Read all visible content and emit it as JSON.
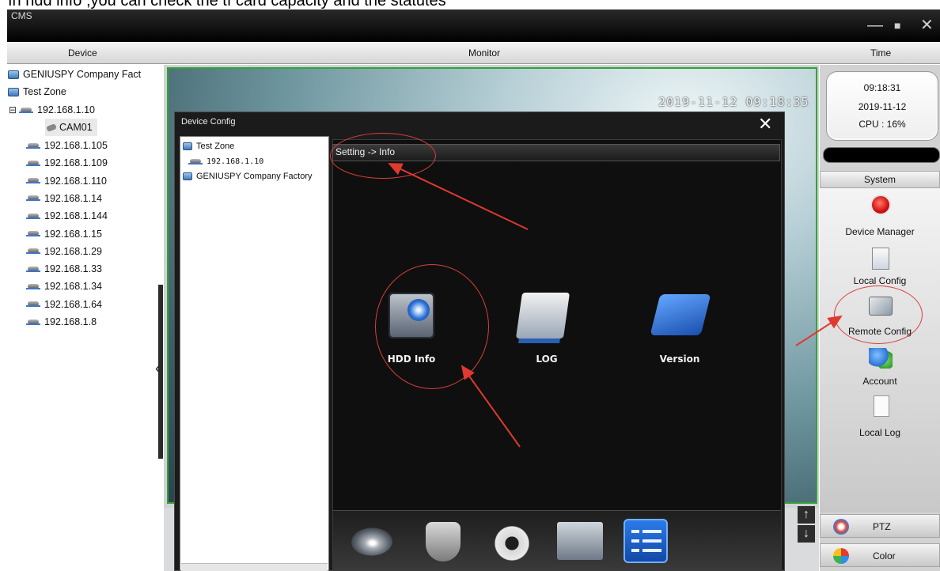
{
  "caption": "In hdd info ,you can check the tf card capacity and the statutes",
  "window": {
    "title": "CMS",
    "controls": {
      "minimize": "—",
      "maximize": "■",
      "close": "✕"
    }
  },
  "headers": {
    "device": "Device",
    "monitor": "Monitor",
    "time": "Time"
  },
  "device_tree": {
    "group_factory": "GENIUSPY Company Fact",
    "group_test_zone": "Test Zone",
    "expander": "⊟",
    "device_selected": "192.168.1.10",
    "camera": "CAM01",
    "devices": [
      "192.168.1.105",
      "192.168.1.109",
      "192.168.1.110",
      "192.168.1.14",
      "192.168.1.144",
      "192.168.1.15",
      "192.168.1.29",
      "192.168.1.33",
      "192.168.1.34",
      "192.168.1.64",
      "192.168.1.8"
    ]
  },
  "video": {
    "timestamp": "2019-11-12 09:18:35"
  },
  "status": {
    "time": "09:18:31",
    "date": "2019-11-12",
    "cpu": "CPU : 16%"
  },
  "system_menu": {
    "header": "System",
    "items": {
      "device_manager": "Device Manager",
      "local_config": "Local Config",
      "remote_config": "Remote Config",
      "account": "Account",
      "local_log": "Local Log"
    }
  },
  "side_buttons": {
    "ptz": "PTZ",
    "color": "Color"
  },
  "dialog": {
    "title": "Device Config",
    "close": "✕",
    "tree": {
      "test_zone": "Test Zone",
      "device": "192.168.1.10",
      "factory": "GENIUSPY Company Factory"
    },
    "breadcrumb": "Setting -> Info",
    "info_items": {
      "hdd": "HDD Info",
      "log": "LOG",
      "version": "Version"
    }
  },
  "scroll": {
    "up": "↑",
    "down": "↓"
  },
  "collapse": "‹",
  "annotation_color": "#d8413b",
  "icons": {
    "folder": "folder-icon",
    "device": "network-device-icon",
    "camera": "camera-icon",
    "toolbar": [
      "disk-icon",
      "shield-icon",
      "gear-icon",
      "monitor-icon",
      "checklist-icon"
    ]
  }
}
